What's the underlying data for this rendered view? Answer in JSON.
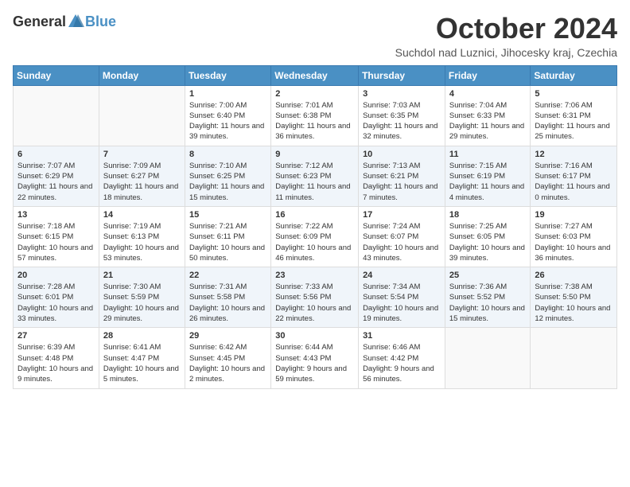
{
  "header": {
    "logo_general": "General",
    "logo_blue": "Blue",
    "month_title": "October 2024",
    "location": "Suchdol nad Luznici, Jihocesky kraj, Czechia"
  },
  "days_of_week": [
    "Sunday",
    "Monday",
    "Tuesday",
    "Wednesday",
    "Thursday",
    "Friday",
    "Saturday"
  ],
  "weeks": [
    [
      {
        "day": "",
        "info": ""
      },
      {
        "day": "",
        "info": ""
      },
      {
        "day": "1",
        "info": "Sunrise: 7:00 AM\nSunset: 6:40 PM\nDaylight: 11 hours and 39 minutes."
      },
      {
        "day": "2",
        "info": "Sunrise: 7:01 AM\nSunset: 6:38 PM\nDaylight: 11 hours and 36 minutes."
      },
      {
        "day": "3",
        "info": "Sunrise: 7:03 AM\nSunset: 6:35 PM\nDaylight: 11 hours and 32 minutes."
      },
      {
        "day": "4",
        "info": "Sunrise: 7:04 AM\nSunset: 6:33 PM\nDaylight: 11 hours and 29 minutes."
      },
      {
        "day": "5",
        "info": "Sunrise: 7:06 AM\nSunset: 6:31 PM\nDaylight: 11 hours and 25 minutes."
      }
    ],
    [
      {
        "day": "6",
        "info": "Sunrise: 7:07 AM\nSunset: 6:29 PM\nDaylight: 11 hours and 22 minutes."
      },
      {
        "day": "7",
        "info": "Sunrise: 7:09 AM\nSunset: 6:27 PM\nDaylight: 11 hours and 18 minutes."
      },
      {
        "day": "8",
        "info": "Sunrise: 7:10 AM\nSunset: 6:25 PM\nDaylight: 11 hours and 15 minutes."
      },
      {
        "day": "9",
        "info": "Sunrise: 7:12 AM\nSunset: 6:23 PM\nDaylight: 11 hours and 11 minutes."
      },
      {
        "day": "10",
        "info": "Sunrise: 7:13 AM\nSunset: 6:21 PM\nDaylight: 11 hours and 7 minutes."
      },
      {
        "day": "11",
        "info": "Sunrise: 7:15 AM\nSunset: 6:19 PM\nDaylight: 11 hours and 4 minutes."
      },
      {
        "day": "12",
        "info": "Sunrise: 7:16 AM\nSunset: 6:17 PM\nDaylight: 11 hours and 0 minutes."
      }
    ],
    [
      {
        "day": "13",
        "info": "Sunrise: 7:18 AM\nSunset: 6:15 PM\nDaylight: 10 hours and 57 minutes."
      },
      {
        "day": "14",
        "info": "Sunrise: 7:19 AM\nSunset: 6:13 PM\nDaylight: 10 hours and 53 minutes."
      },
      {
        "day": "15",
        "info": "Sunrise: 7:21 AM\nSunset: 6:11 PM\nDaylight: 10 hours and 50 minutes."
      },
      {
        "day": "16",
        "info": "Sunrise: 7:22 AM\nSunset: 6:09 PM\nDaylight: 10 hours and 46 minutes."
      },
      {
        "day": "17",
        "info": "Sunrise: 7:24 AM\nSunset: 6:07 PM\nDaylight: 10 hours and 43 minutes."
      },
      {
        "day": "18",
        "info": "Sunrise: 7:25 AM\nSunset: 6:05 PM\nDaylight: 10 hours and 39 minutes."
      },
      {
        "day": "19",
        "info": "Sunrise: 7:27 AM\nSunset: 6:03 PM\nDaylight: 10 hours and 36 minutes."
      }
    ],
    [
      {
        "day": "20",
        "info": "Sunrise: 7:28 AM\nSunset: 6:01 PM\nDaylight: 10 hours and 33 minutes."
      },
      {
        "day": "21",
        "info": "Sunrise: 7:30 AM\nSunset: 5:59 PM\nDaylight: 10 hours and 29 minutes."
      },
      {
        "day": "22",
        "info": "Sunrise: 7:31 AM\nSunset: 5:58 PM\nDaylight: 10 hours and 26 minutes."
      },
      {
        "day": "23",
        "info": "Sunrise: 7:33 AM\nSunset: 5:56 PM\nDaylight: 10 hours and 22 minutes."
      },
      {
        "day": "24",
        "info": "Sunrise: 7:34 AM\nSunset: 5:54 PM\nDaylight: 10 hours and 19 minutes."
      },
      {
        "day": "25",
        "info": "Sunrise: 7:36 AM\nSunset: 5:52 PM\nDaylight: 10 hours and 15 minutes."
      },
      {
        "day": "26",
        "info": "Sunrise: 7:38 AM\nSunset: 5:50 PM\nDaylight: 10 hours and 12 minutes."
      }
    ],
    [
      {
        "day": "27",
        "info": "Sunrise: 6:39 AM\nSunset: 4:48 PM\nDaylight: 10 hours and 9 minutes."
      },
      {
        "day": "28",
        "info": "Sunrise: 6:41 AM\nSunset: 4:47 PM\nDaylight: 10 hours and 5 minutes."
      },
      {
        "day": "29",
        "info": "Sunrise: 6:42 AM\nSunset: 4:45 PM\nDaylight: 10 hours and 2 minutes."
      },
      {
        "day": "30",
        "info": "Sunrise: 6:44 AM\nSunset: 4:43 PM\nDaylight: 9 hours and 59 minutes."
      },
      {
        "day": "31",
        "info": "Sunrise: 6:46 AM\nSunset: 4:42 PM\nDaylight: 9 hours and 56 minutes."
      },
      {
        "day": "",
        "info": ""
      },
      {
        "day": "",
        "info": ""
      }
    ]
  ]
}
